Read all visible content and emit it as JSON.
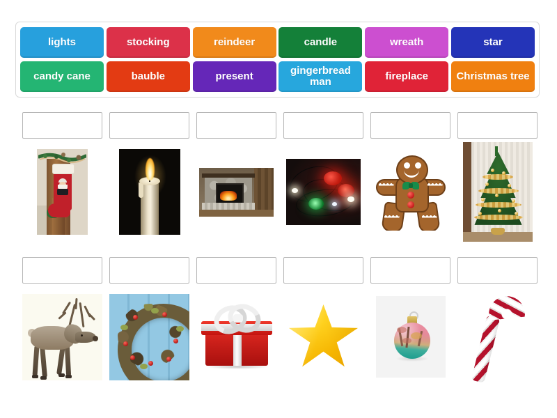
{
  "activity": {
    "type": "match-up",
    "theme": "Christmas vocabulary"
  },
  "word_bank": {
    "rows": [
      [
        {
          "label": "lights",
          "color": "#27a0dd"
        },
        {
          "label": "stocking",
          "color": "#dc3149"
        },
        {
          "label": "reindeer",
          "color": "#f18a1b"
        },
        {
          "label": "candle",
          "color": "#148039"
        },
        {
          "label": "wreath",
          "color": "#cc4fd0"
        },
        {
          "label": "star",
          "color": "#2434b8"
        }
      ],
      [
        {
          "label": "candy cane",
          "color": "#24b573"
        },
        {
          "label": "bauble",
          "color": "#e33b13"
        },
        {
          "label": "present",
          "color": "#6527b8"
        },
        {
          "label": "gingerbread man",
          "color": "#27a7dd"
        },
        {
          "label": "fireplace",
          "color": "#e02337"
        },
        {
          "label": "Christmas tree",
          "color": "#f08010"
        }
      ]
    ]
  },
  "drop_zones": {
    "row_1": [
      "",
      "",
      "",
      "",
      "",
      ""
    ],
    "row_2": [
      "",
      "",
      "",
      "",
      "",
      ""
    ]
  },
  "image_rows": [
    {
      "items": [
        {
          "name": "stocking-image",
          "alt": "stocking"
        },
        {
          "name": "candle-image",
          "alt": "candle"
        },
        {
          "name": "fireplace-image",
          "alt": "fireplace"
        },
        {
          "name": "lights-image",
          "alt": "lights"
        },
        {
          "name": "gingerbread-man-image",
          "alt": "gingerbread man"
        },
        {
          "name": "christmas-tree-image",
          "alt": "Christmas tree"
        }
      ]
    },
    {
      "items": [
        {
          "name": "reindeer-image",
          "alt": "reindeer"
        },
        {
          "name": "wreath-image",
          "alt": "wreath"
        },
        {
          "name": "present-image",
          "alt": "present"
        },
        {
          "name": "star-image",
          "alt": "star"
        },
        {
          "name": "bauble-image",
          "alt": "bauble"
        },
        {
          "name": "candy-cane-image",
          "alt": "candy cane"
        }
      ]
    }
  ],
  "colors": {
    "page_background": "#ffffff",
    "bank_border": "#d9d9d9",
    "drop_zone_border": "#b6b6b6",
    "tile_text": "#ffffff"
  }
}
